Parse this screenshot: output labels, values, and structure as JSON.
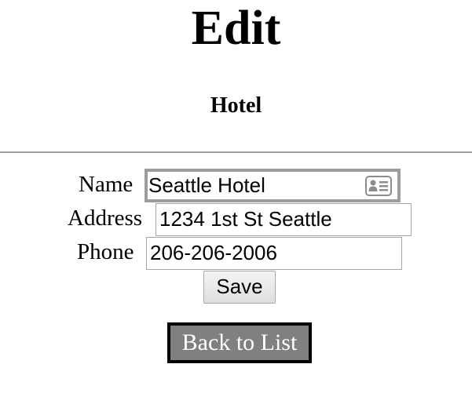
{
  "page": {
    "title": "Edit",
    "subtitle": "Hotel"
  },
  "form": {
    "name": {
      "label": "Name",
      "value": "Seattle Hotel",
      "icon": "contact-card-icon"
    },
    "address": {
      "label": "Address",
      "value": "1234 1st St Seattle"
    },
    "phone": {
      "label": "Phone",
      "value": "206-206-2006"
    },
    "save_label": "Save"
  },
  "nav": {
    "back_label": "Back to List"
  },
  "colors": {
    "back_button_bg": "#808080",
    "back_button_border": "#000000",
    "divider": "#a0a0a0"
  }
}
